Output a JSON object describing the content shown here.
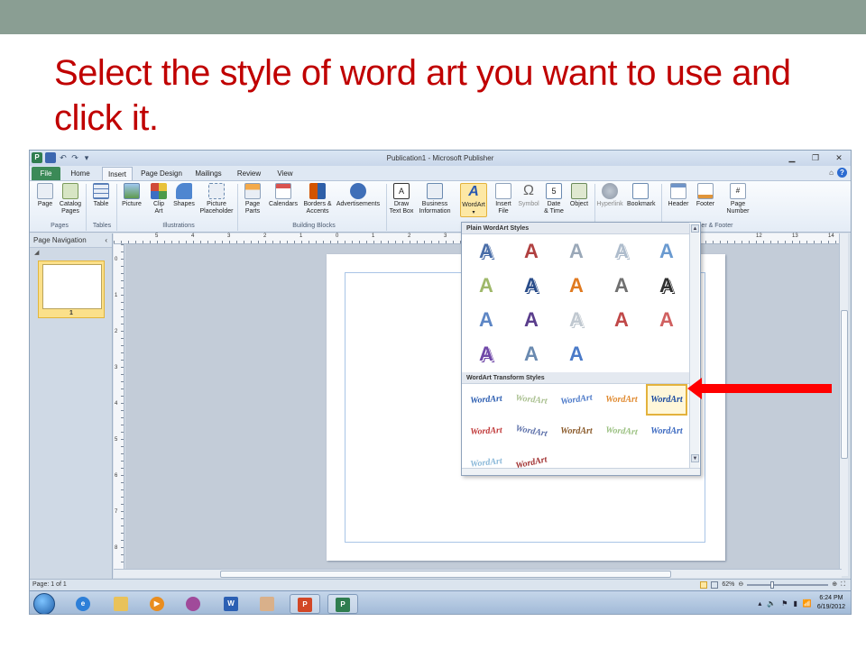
{
  "slide": {
    "title": "Select the style of word art you want to use and click it."
  },
  "window": {
    "title": "Publication1 - Microsoft Publisher",
    "app_icon_letter": "P"
  },
  "tabs": [
    "File",
    "Home",
    "Insert",
    "Page Design",
    "Mailings",
    "Review",
    "View"
  ],
  "ribbon": {
    "buttons": [
      {
        "label": "Page",
        "sub": ""
      },
      {
        "label": "Catalog",
        "sub": "Pages"
      },
      {
        "label": "Table",
        "sub": ""
      },
      {
        "label": "Picture",
        "sub": ""
      },
      {
        "label": "Clip",
        "sub": "Art"
      },
      {
        "label": "Shapes",
        "sub": ""
      },
      {
        "label": "Picture",
        "sub": "Placeholder"
      },
      {
        "label": "Page",
        "sub": "Parts"
      },
      {
        "label": "Calendars",
        "sub": ""
      },
      {
        "label": "Borders &",
        "sub": "Accents"
      },
      {
        "label": "Advertisements",
        "sub": ""
      },
      {
        "label": "Draw",
        "sub": "Text Box"
      },
      {
        "label": "Business",
        "sub": "Information"
      },
      {
        "label": "WordArt",
        "sub": ""
      },
      {
        "label": "Insert",
        "sub": "File"
      },
      {
        "label": "Symbol",
        "sub": ""
      },
      {
        "label": "Date",
        "sub": "& Time"
      },
      {
        "label": "Object",
        "sub": ""
      },
      {
        "label": "Hyperlink",
        "sub": ""
      },
      {
        "label": "Bookmark",
        "sub": ""
      },
      {
        "label": "Header",
        "sub": ""
      },
      {
        "label": "Footer",
        "sub": ""
      },
      {
        "label": "Page",
        "sub": "Number"
      }
    ],
    "groups": [
      "Pages",
      "Tables",
      "Illustrations",
      "Building Blocks",
      "der & Footer"
    ]
  },
  "nav_pane": {
    "title": "Page Navigation",
    "thumbnail_number": "1"
  },
  "rulers": {
    "top": [
      "5",
      "4",
      "3",
      "2",
      "1",
      "0",
      "1",
      "2",
      "3",
      "12",
      "13",
      "14"
    ],
    "left": [
      "0",
      "1",
      "2",
      "3",
      "4",
      "5",
      "6",
      "7",
      "8"
    ]
  },
  "wordart_gallery": {
    "plain_header": "Plain WordArt Styles",
    "transform_header": "WordArt Transform Styles",
    "plain_glyph": "A",
    "transform_text": "WordArt",
    "plain_colors": [
      "#4a6ea8",
      "#b04040",
      "#9aa8b8",
      "#aebccc",
      "#6a9ad0",
      "#9fb86a",
      "#2a4d8a",
      "#e07a20",
      "#707070",
      "#303030",
      "#5d86c5",
      "#5a3e8c",
      "#c0c8d0",
      "#c04848",
      "#d06060",
      "#7048a8",
      "#6a8ab0",
      "#4a7ac8"
    ],
    "transform_colors": [
      "#2a5cb0",
      "#aac090",
      "#4a78c8",
      "#e08a30",
      "#1a4aa0",
      "#c03838",
      "#5a6ea8",
      "#8a5a2a",
      "#9ac080",
      "#3a68c0",
      "#8ab8d8",
      "#a03030"
    ]
  },
  "status": {
    "page_info": "Page: 1 of 1",
    "zoom": "62%"
  },
  "taskbar": {
    "time": "6:24 PM",
    "date": "6/19/2012"
  },
  "colors": {
    "title_red": "#c00000",
    "arrow_red": "#ff0000",
    "topbar": "#8a9e93"
  }
}
